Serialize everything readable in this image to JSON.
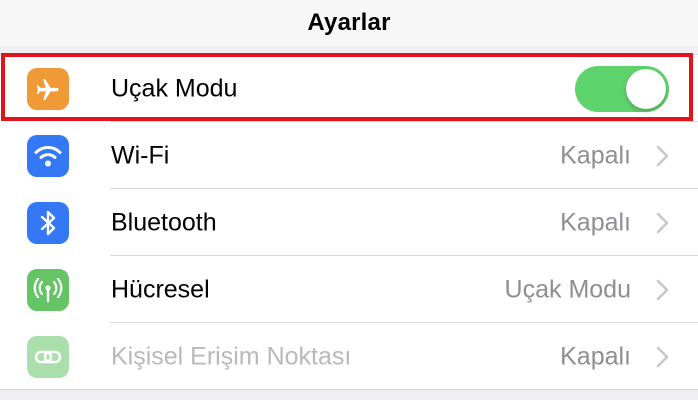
{
  "header": {
    "title": "Ayarlar"
  },
  "rows": [
    {
      "label": "Uçak Modu",
      "icon": "airplane-icon",
      "color": "#f09a37",
      "toggle_on": true
    },
    {
      "label": "Wi-Fi",
      "value": "Kapalı",
      "icon": "wifi-icon",
      "color": "#3478f6"
    },
    {
      "label": "Bluetooth",
      "value": "Kapalı",
      "icon": "bluetooth-icon",
      "color": "#3478f6"
    },
    {
      "label": "Hücresel",
      "value": "Uçak Modu",
      "icon": "cellular-antenna-icon",
      "color": "#65c466"
    },
    {
      "label": "Kişisel Erişim Noktası",
      "value": "Kapalı",
      "icon": "personal-hotspot-icon",
      "color": "#65c466",
      "disabled": true
    }
  ],
  "highlight_color": "#e0141d",
  "toggle_color": "#5fd36b"
}
